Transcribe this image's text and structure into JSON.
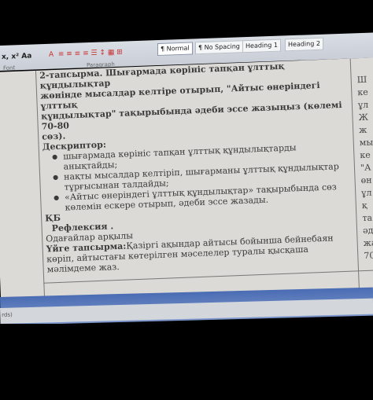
{
  "ribbon": {
    "format_buttons": "x, x² Aa",
    "group_font": "Font",
    "group_paragraph": "Paragraph",
    "styles": [
      "¶ Normal",
      "¶ No Spacing",
      "Heading 1",
      "Heading 2"
    ]
  },
  "document": {
    "task2_line1": "2-тапсырма. Шығармада көрініс тапқан ұлттық құндылықтар",
    "task2_line2": "жөнінде мысалдар келтіре отырып, \"Айтыс өнеріндегі ұлттық",
    "task2_line3": "құндылықтар\" тақырыбында әдеби эссе жазыңыз (көлемі 70-80",
    "task2_line4": "сөз).",
    "descriptor_label": "Дескриптор:",
    "bullets": [
      "шығармада көрініс тапқан ұлттық құндылықтарды анықтайды;",
      "нақты мысалдар келтіріп, шығарманы ұлттық құндылықтар тұрғысынан талдайды;",
      "«Айтыс өнеріндегі ұлттық құндылықтар» тақырыбында сөз көлемін ескере отырып, әдеби эссе жазады."
    ],
    "kb_label": "ҚБ",
    "reflection_label": "Рефлексия .",
    "reflection_text": "Одағайлар арқылы",
    "homework_label": "Үйге тапсырма:",
    "homework_text": "Қазіргі ақындар айтысы бойынша бейнебаян көріп, айтыстағы көтерілген мәселелер туралы қысқаша мәлімдеме жаз.",
    "right_column": [
      "Ш",
      "ке",
      "ұл",
      "Ж",
      "ж",
      "мы",
      "ке",
      "\"А",
      "өн",
      "ұл",
      "қ",
      "та",
      "әд",
      "жа",
      "70"
    ]
  },
  "statusbar": {
    "text": "rds)"
  }
}
